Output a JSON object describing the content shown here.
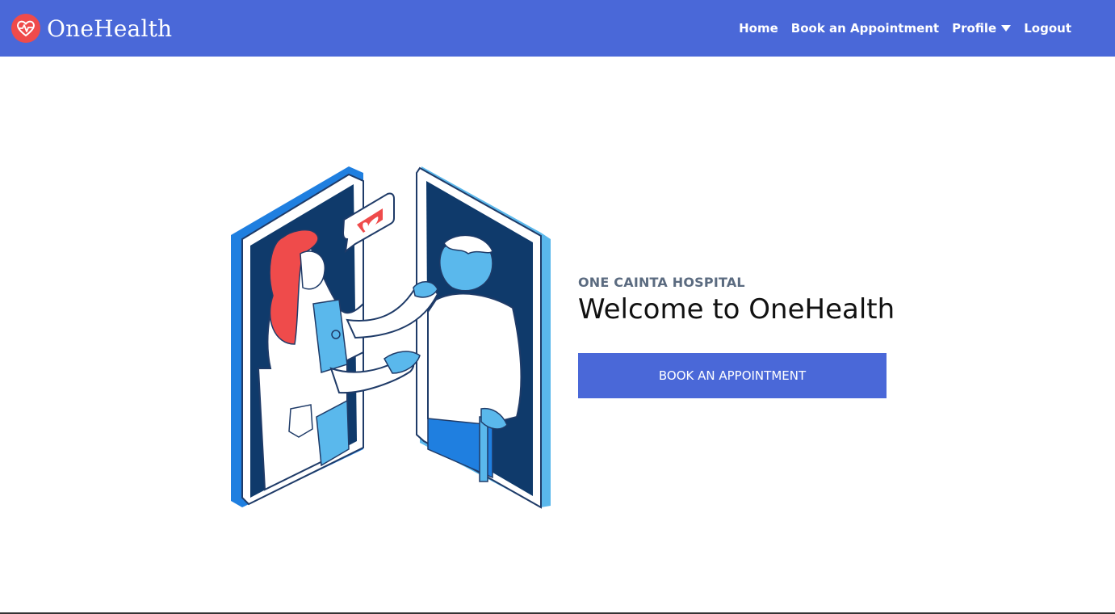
{
  "brand": {
    "name": "OneHealth",
    "logo_icon": "heart-pulse-icon",
    "logo_color": "#ef4b4b"
  },
  "nav": {
    "background": "#4a68d8",
    "items": [
      {
        "label": "Home"
      },
      {
        "label": "Book an Appointment"
      },
      {
        "label": "Profile",
        "icon": "caret-down-icon"
      },
      {
        "label": "Logout"
      }
    ]
  },
  "hero": {
    "kicker": "ONE CAINTA HOSPITAL",
    "headline": "Welcome to OneHealth",
    "cta_label": "BOOK AN APPOINTMENT"
  }
}
